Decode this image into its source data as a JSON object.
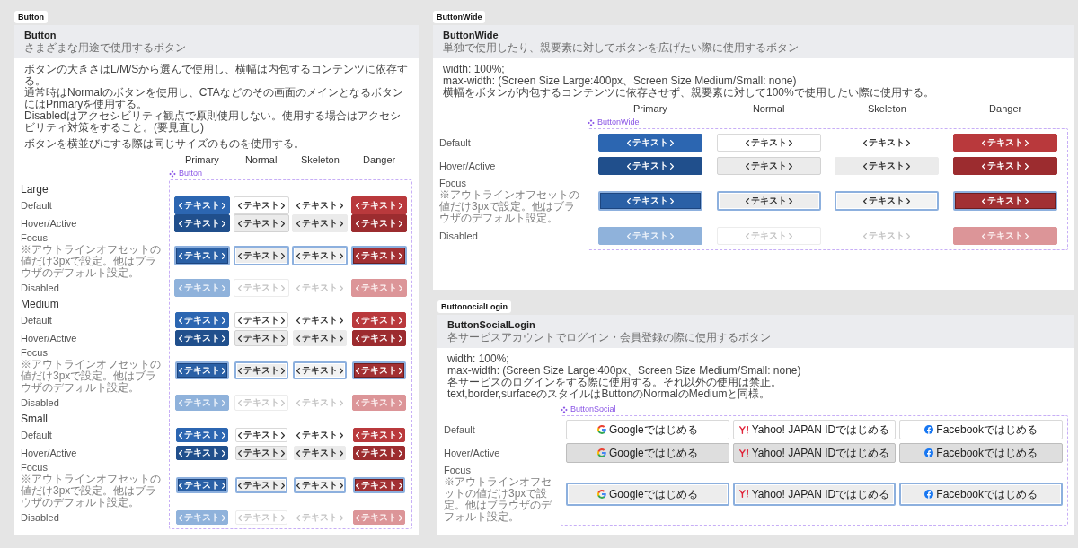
{
  "frames": [
    {
      "kind": "sized",
      "frame_label": "Button",
      "title": "Button",
      "subtitle": "さまざまな用途で使用するボタン",
      "description": [
        [
          "ボタンの大きさはL/M/Sから選んで使用し、横幅は内包するコンテンツに依存する。",
          "通常時はNormalのボタンを使用し、CTAなどのその画面のメインとなるボタンにはPrimaryを使用する。",
          "Disabledはアクセシビリティ観点で原則使用しない。使用する場合はアクセシビリティ対策をすること。(要見直し)"
        ],
        [
          "ボタンを横並びにする際は同じサイズのものを使用する。"
        ]
      ],
      "component": "Button",
      "columns": [
        {
          "label": "Primary",
          "kind": "primary"
        },
        {
          "label": "Normal",
          "kind": "normal"
        },
        {
          "label": "Skeleton",
          "kind": "skeleton"
        },
        {
          "label": "Danger",
          "kind": "danger"
        }
      ],
      "sections": [
        {
          "title": "Large",
          "kind": "large",
          "rows": [
            {
              "label": "Default",
              "hovered": false,
              "focused": false,
              "disabled": false,
              "cells": [
                "テキスト",
                "テキスト",
                "テキスト",
                "テキスト"
              ]
            },
            {
              "label": "Hover/Active",
              "hovered": true,
              "focused": false,
              "disabled": false,
              "cells": [
                "テキスト",
                "テキスト",
                "テキスト",
                "テキスト"
              ]
            },
            {
              "label": "Focus",
              "note": "※アウトラインオフセットの値だけ3pxで設定。他はブラウザのデフォルト設定。",
              "hovered": false,
              "focused": true,
              "disabled": false,
              "cells": [
                "テキスト",
                "テキスト",
                "テキスト",
                "テキスト"
              ]
            },
            {
              "label": "Disabled",
              "hovered": false,
              "focused": false,
              "disabled": true,
              "cells": [
                "テキスト",
                "テキスト",
                "テキスト",
                "テキスト"
              ]
            }
          ]
        },
        {
          "title": "Medium",
          "kind": "medium",
          "rows": [
            {
              "label": "Default",
              "hovered": false,
              "focused": false,
              "disabled": false,
              "cells": [
                "テキスト",
                "テキスト",
                "テキスト",
                "テキスト"
              ]
            },
            {
              "label": "Hover/Active",
              "hovered": true,
              "focused": false,
              "disabled": false,
              "cells": [
                "テキスト",
                "テキスト",
                "テキスト",
                "テキスト"
              ]
            },
            {
              "label": "Focus",
              "note": "※アウトラインオフセットの値だけ3pxで設定。他はブラウザのデフォルト設定。",
              "hovered": false,
              "focused": true,
              "disabled": false,
              "cells": [
                "テキスト",
                "テキスト",
                "テキスト",
                "テキスト"
              ]
            },
            {
              "label": "Disabled",
              "hovered": false,
              "focused": false,
              "disabled": true,
              "cells": [
                "テキスト",
                "テキスト",
                "テキスト",
                "テキスト"
              ]
            }
          ]
        },
        {
          "title": "Small",
          "kind": "small",
          "rows": [
            {
              "label": "Default",
              "hovered": false,
              "focused": false,
              "disabled": false,
              "cells": [
                "テキスト",
                "テキスト",
                "テキスト",
                "テキスト"
              ]
            },
            {
              "label": "Hover/Active",
              "hovered": true,
              "focused": false,
              "disabled": false,
              "cells": [
                "テキスト",
                "テキスト",
                "テキスト",
                "テキスト"
              ]
            },
            {
              "label": "Focus",
              "note": "※アウトラインオフセットの値だけ3pxで設定。他はブラウザのデフォルト設定。",
              "hovered": false,
              "focused": true,
              "disabled": false,
              "cells": [
                "テキスト",
                "テキスト",
                "テキスト",
                "テキスト"
              ]
            },
            {
              "label": "Disabled",
              "hovered": false,
              "focused": false,
              "disabled": true,
              "cells": [
                "テキスト",
                "テキスト",
                "テキスト",
                "テキスト"
              ]
            }
          ]
        }
      ]
    },
    {
      "kind": "wide",
      "frame_label": "ButtonWide",
      "title": "ButtonWide",
      "subtitle": "単独で使用したり、親要素に対してボタンを広げたい際に使用するボタン",
      "description": [
        [
          "width: 100%;",
          "max-width: (Screen Size Large:400px、Screen Size Medium/Small: none)",
          "横幅をボタンが内包するコンテンツに依存させず、親要素に対して100%で使用したい際に使用する。"
        ]
      ],
      "component": "ButtonWide",
      "columns": [
        {
          "label": "Primary",
          "kind": "primary"
        },
        {
          "label": "Normal",
          "kind": "normal"
        },
        {
          "label": "Skeleton",
          "kind": "skeleton"
        },
        {
          "label": "Danger",
          "kind": "danger"
        }
      ],
      "sections": [
        {
          "kind": "large",
          "rows": [
            {
              "label": "Default",
              "hovered": false,
              "focused": false,
              "disabled": false,
              "cells": [
                "テキスト",
                "テキスト",
                "テキスト",
                "テキスト"
              ]
            },
            {
              "label": "Hover/Active",
              "hovered": true,
              "focused": false,
              "disabled": false,
              "cells": [
                "テキスト",
                "テキスト",
                "テキスト",
                "テキスト"
              ]
            },
            {
              "label": "Focus",
              "note": "※アウトラインオフセットの値だけ3pxで設定。他はブラウザのデフォルト設定。",
              "hovered": false,
              "focused": true,
              "disabled": false,
              "cells": [
                "テキスト",
                "テキスト",
                "テキスト",
                "テキスト"
              ]
            },
            {
              "label": "Disabled",
              "hovered": false,
              "focused": false,
              "disabled": true,
              "cells": [
                "テキスト",
                "テキスト",
                "テキスト",
                "テキスト"
              ]
            }
          ]
        }
      ]
    },
    {
      "kind": "social",
      "frame_label": "ButtonocialLogin",
      "title": "ButtonSocialLogin",
      "subtitle": "各サービスアカウントでログイン・会員登録の際に使用するボタン",
      "description": [
        [
          "width: 100%;",
          "max-width: (Screen Size Large:400px、Screen Size Medium/Small: none)",
          "各サービスのログインをする際に使用する。それ以外の使用は禁止。",
          "text,border,surfaceのスタイルはButtonのNormalのMediumと同様。"
        ]
      ],
      "component": "ButtonSocial",
      "sections": [
        {
          "kind": "medium",
          "rows": [
            {
              "label": "Default",
              "hovered": false,
              "focused": false,
              "disabled": false,
              "cells": [
                {
                  "kind": "google",
                  "text": "Googleではじめる"
                },
                {
                  "kind": "yahoo",
                  "text": "Yahoo! JAPAN IDではじめる"
                },
                {
                  "kind": "facebook",
                  "text": "Facebookではじめる"
                }
              ]
            },
            {
              "label": "Hover/Active",
              "hovered": true,
              "focused": false,
              "disabled": false,
              "cells": [
                {
                  "kind": "google",
                  "text": "Googleではじめる"
                },
                {
                  "kind": "yahoo",
                  "text": "Yahoo! JAPAN IDではじめる"
                },
                {
                  "kind": "facebook",
                  "text": "Facebookではじめる"
                }
              ]
            },
            {
              "label": "Focus",
              "note": "※アウトラインオフセットの値だけ3pxで設定。他はブラウザのデフォルト設定。",
              "hovered": false,
              "focused": true,
              "disabled": false,
              "cells": [
                {
                  "kind": "google",
                  "text": "Googleではじめる"
                },
                {
                  "kind": "yahoo",
                  "text": "Yahoo! JAPAN IDではじめる"
                },
                {
                  "kind": "facebook",
                  "text": "Facebookではじめる"
                }
              ]
            }
          ]
        }
      ]
    }
  ]
}
